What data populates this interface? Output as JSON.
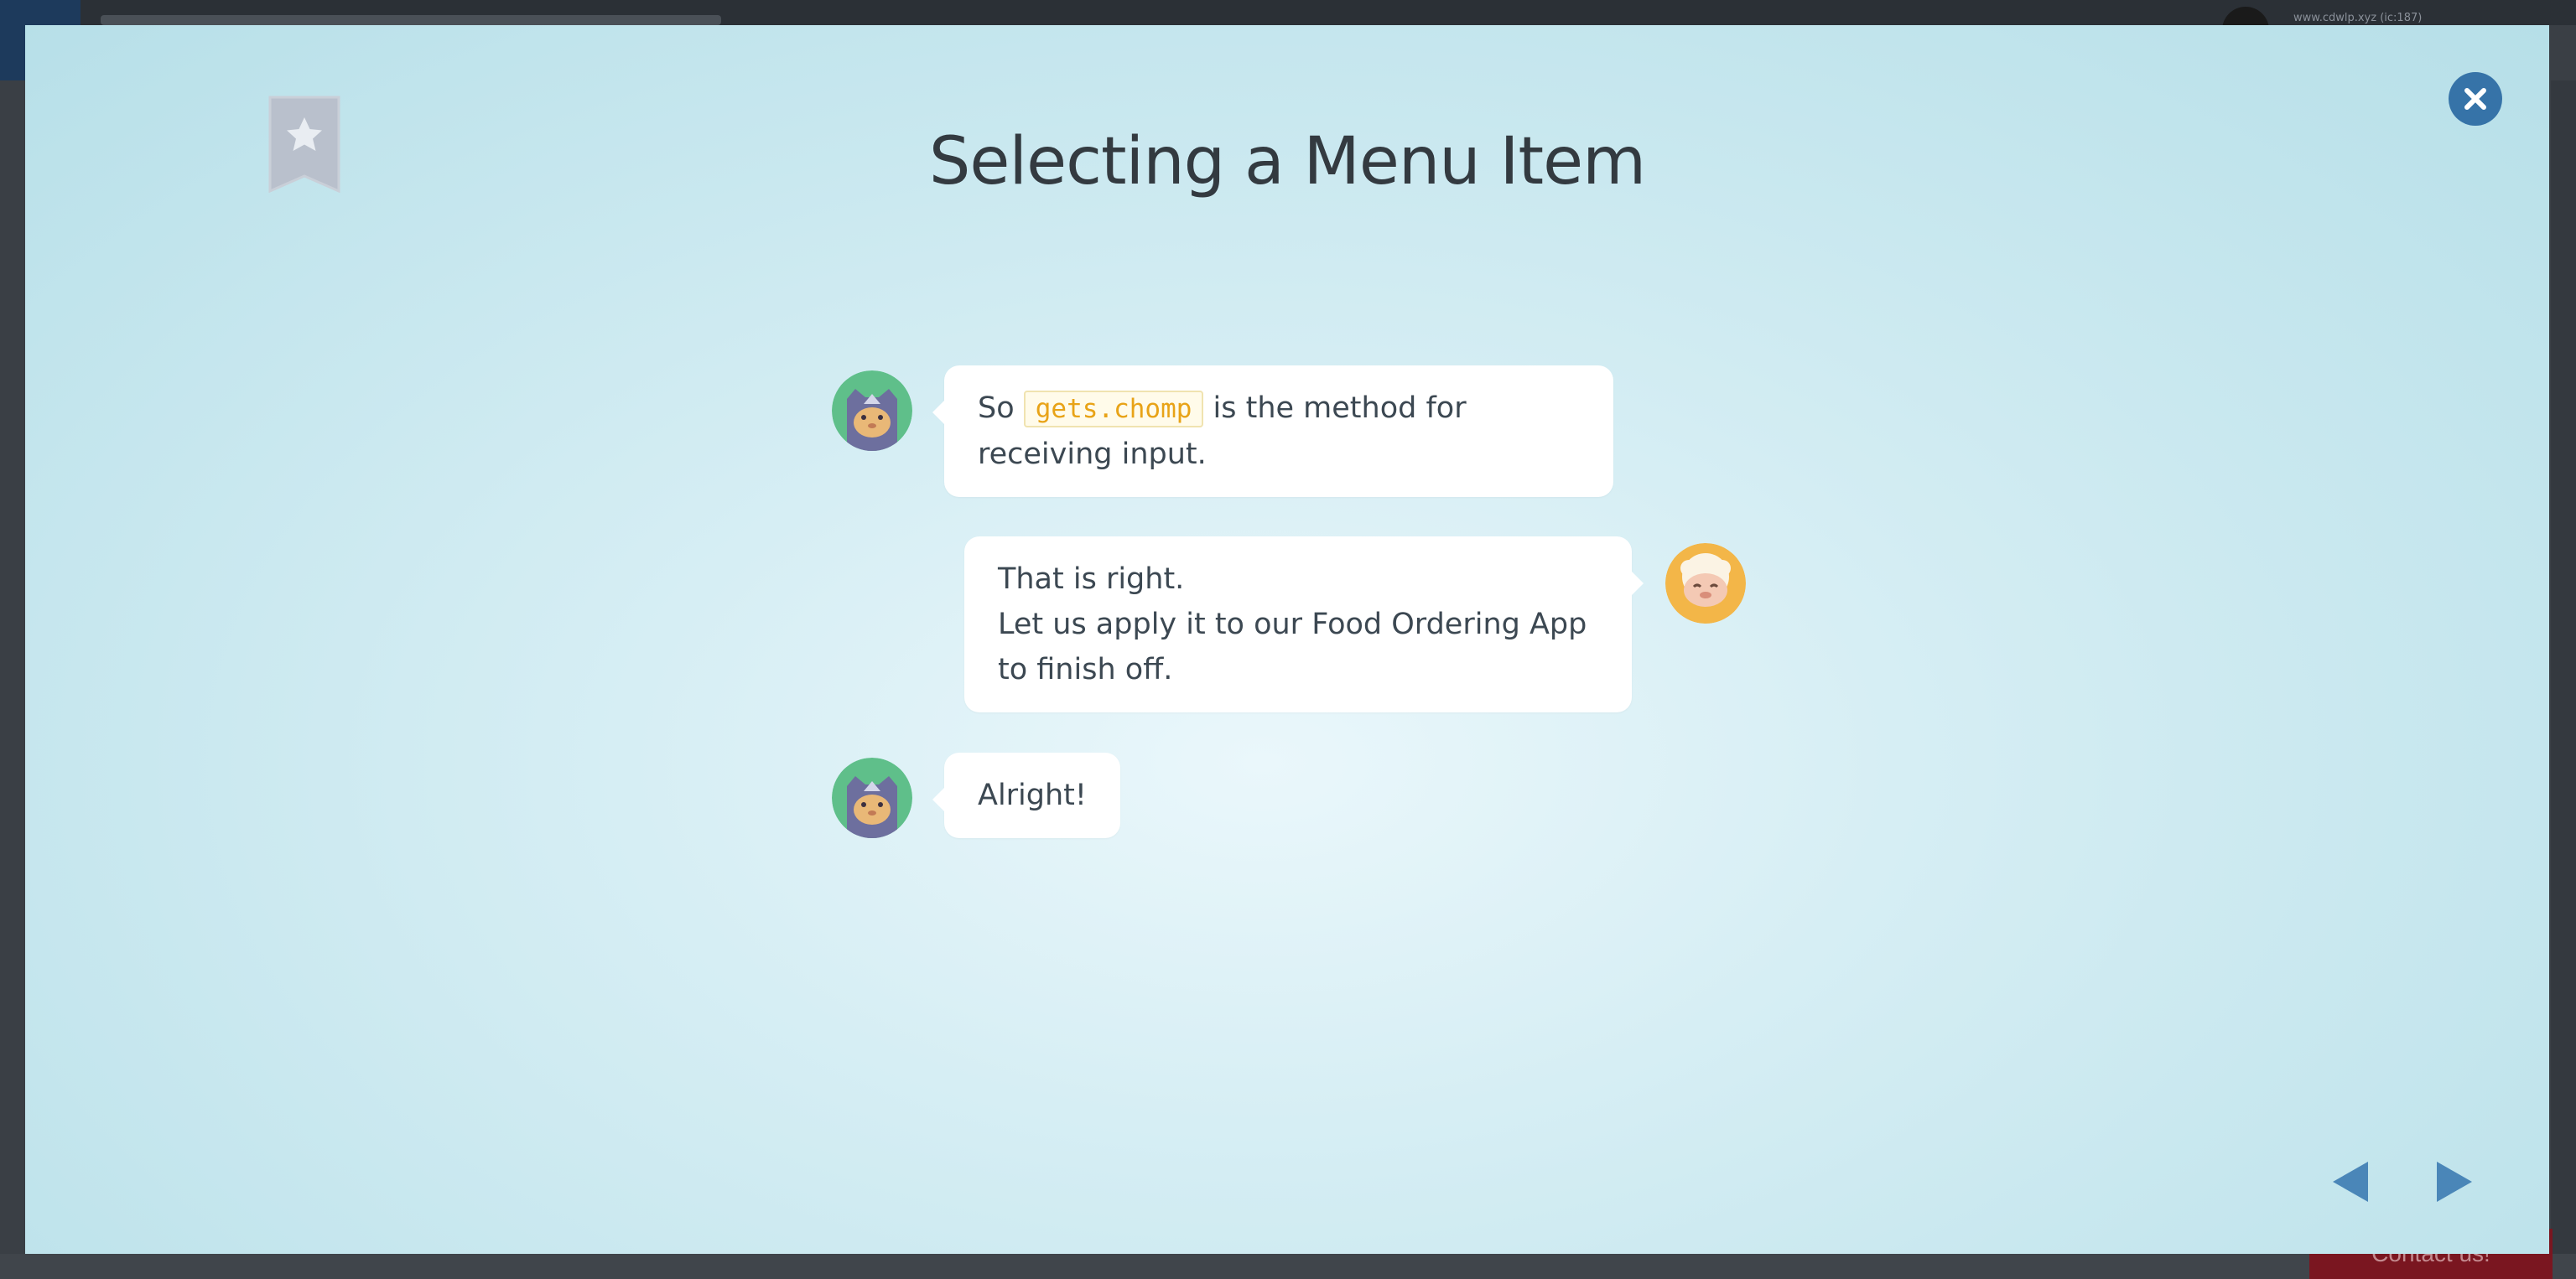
{
  "background_app": {
    "user_email": "www.cdwlp.xyz (ic:187)",
    "contact_label": "Contact us!"
  },
  "modal": {
    "title": "Selecting a Menu Item",
    "messages": [
      {
        "speaker": "cat",
        "side": "left",
        "before_code": "So ",
        "code": "gets.chomp",
        "after_code": " is the method for receiving input."
      },
      {
        "speaker": "sheep",
        "side": "right",
        "line1": "That is right.",
        "line2": "Let us apply it to our Food Ordering App to finish off."
      },
      {
        "speaker": "cat",
        "side": "left",
        "text": "Alright!"
      }
    ],
    "icons": {
      "bookmark": "bookmark-star-icon",
      "close": "close-icon",
      "prev": "previous-arrow-icon",
      "next": "next-arrow-icon"
    },
    "colors": {
      "close_button": "#3673a8",
      "nav_arrow": "#4a86b8",
      "code_text": "#e8a317",
      "cat_avatar_bg": "#5fbf8a",
      "sheep_avatar_bg": "#f3b648"
    }
  }
}
